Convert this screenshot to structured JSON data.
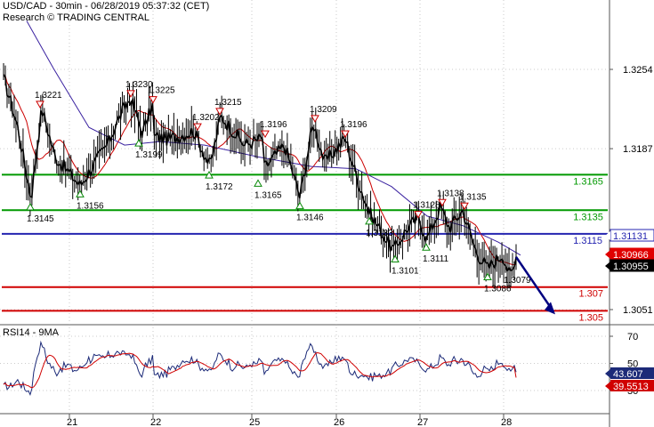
{
  "header": {
    "title": "USD/CAD - 30min - 06/28/2019 05:37:32 (CET)",
    "source": "Research © TRADING CENTRAL"
  },
  "rsi_panel": {
    "title": "RSI14 - 9MA"
  },
  "colors": {
    "price": "#000000",
    "ma_fast": "#cc0000",
    "ma_slow": "#3a22a0",
    "support": "#009900",
    "pivot": "#2424b0",
    "target": "#d00000",
    "arrow": "#000080",
    "up_marker": "#0a8a0a",
    "down_marker": "#cc0000"
  },
  "chart_data": [
    {
      "type": "candlestick",
      "title": "USD/CAD - 30min",
      "x_ticks": [
        "21",
        "22",
        "25",
        "26",
        "27",
        "28"
      ],
      "y_ticks": [
        1.3254,
        1.3187,
        1.3051
      ],
      "ylim": [
        1.3035,
        1.33
      ],
      "price_path": [
        {
          "label": "start",
          "y": 1.3245
        },
        {
          "label": "",
          "y": 1.3205
        },
        {
          "label": "low",
          "y": 1.3145
        },
        {
          "label": "",
          "y": 1.321
        },
        {
          "label": "high",
          "y": 1.3221
        },
        {
          "label": "",
          "y": 1.318
        },
        {
          "label": "low",
          "y": 1.3156
        },
        {
          "label": "",
          "y": 1.319
        },
        {
          "label": "",
          "y": 1.3215
        },
        {
          "label": "high",
          "y": 1.323
        },
        {
          "label": "",
          "y": 1.32
        },
        {
          "label": "high",
          "y": 1.3225
        },
        {
          "label": "low",
          "y": 1.3199
        },
        {
          "label": "",
          "y": 1.3195
        },
        {
          "label": "high",
          "y": 1.3202
        },
        {
          "label": "low",
          "y": 1.3172
        },
        {
          "label": "",
          "y": 1.32
        },
        {
          "label": "high",
          "y": 1.3215
        },
        {
          "label": "",
          "y": 1.319
        },
        {
          "label": "high",
          "y": 1.3196
        },
        {
          "label": "low",
          "y": 1.3165
        },
        {
          "label": "",
          "y": 1.319
        },
        {
          "label": "low",
          "y": 1.3146
        },
        {
          "label": "high",
          "y": 1.3209
        },
        {
          "label": "",
          "y": 1.3175
        },
        {
          "label": "high",
          "y": 1.3196
        },
        {
          "label": "",
          "y": 1.3165
        },
        {
          "label": "low",
          "y": 1.3133
        },
        {
          "label": "low",
          "y": 1.3101
        },
        {
          "label": "",
          "y": 1.312
        },
        {
          "label": "high",
          "y": 1.3128
        },
        {
          "label": "low",
          "y": 1.3111
        },
        {
          "label": "high",
          "y": 1.3138
        },
        {
          "label": "",
          "y": 1.312
        },
        {
          "label": "high",
          "y": 1.3135
        },
        {
          "label": "",
          "y": 1.31
        },
        {
          "label": "low",
          "y": 1.3086
        },
        {
          "label": "",
          "y": 1.3098
        },
        {
          "label": "low",
          "y": 1.3079
        },
        {
          "label": "last",
          "y": 1.30955
        }
      ],
      "series": [
        {
          "name": "",
          "values": "moving average (fast, red)"
        },
        {
          "name": "",
          "values": "moving average (slow, purple)"
        }
      ],
      "markers_down": [
        {
          "value": 1.3221,
          "label": "1.3221"
        },
        {
          "value": 1.323,
          "label": "1.3230"
        },
        {
          "value": 1.3225,
          "label": "1.3225"
        },
        {
          "value": 1.3202,
          "label": "1.3202"
        },
        {
          "value": 1.3215,
          "label": "1.3215"
        },
        {
          "value": 1.3196,
          "label": "1.3196"
        },
        {
          "value": 1.3209,
          "label": "1.3209"
        },
        {
          "value": 1.3196,
          "label": "1.3196"
        },
        {
          "value": 1.3128,
          "label": "1.3128"
        },
        {
          "value": 1.3138,
          "label": "1.3138"
        },
        {
          "value": 1.3135,
          "label": "1.3135"
        }
      ],
      "markers_up": [
        {
          "value": 1.3145,
          "label": "1.3145"
        },
        {
          "value": 1.3156,
          "label": "1.3156"
        },
        {
          "value": 1.3199,
          "label": "1.3199"
        },
        {
          "value": 1.3172,
          "label": "1.3172"
        },
        {
          "value": 1.3165,
          "label": "1.3165"
        },
        {
          "value": 1.3146,
          "label": "1.3146"
        },
        {
          "value": 1.3133,
          "label": "1.3133"
        },
        {
          "value": 1.3101,
          "label": "1.3101"
        },
        {
          "value": 1.3111,
          "label": "1.3111"
        },
        {
          "value": 1.3086,
          "label": "1.3086"
        }
      ],
      "low_label": {
        "value": 1.3079,
        "label": "1.3079"
      },
      "levels": [
        {
          "value": 1.3165,
          "label": "1.3165",
          "kind": "support"
        },
        {
          "value": 1.3135,
          "label": "1.3135",
          "kind": "support"
        },
        {
          "value": 1.3115,
          "label": "1.3115",
          "kind": "pivot"
        },
        {
          "value": 1.307,
          "label": "1.307",
          "kind": "target"
        },
        {
          "value": 1.305,
          "label": "1.305",
          "kind": "target"
        }
      ],
      "price_tags": [
        {
          "value": 1.31131,
          "label": "1.31131",
          "bg": "#ffffff",
          "fg": "#2424b0",
          "border": "#2424b0"
        },
        {
          "value": 1.30966,
          "label": "1.30966",
          "bg": "#e00000",
          "fg": "#ffffff",
          "border": "#e00000"
        },
        {
          "value": 1.30955,
          "label": "1.30955",
          "bg": "#000000",
          "fg": "#ffffff",
          "border": "#000000"
        }
      ],
      "forecast_arrow": {
        "from": 1.30955,
        "to": 1.305
      }
    },
    {
      "type": "line",
      "title": "RSI14 - 9MA",
      "y_ticks": [
        70,
        50,
        30
      ],
      "ylim": [
        15,
        82
      ],
      "rsi_value": 43.607,
      "rsi_ma_value": 39.5513,
      "tags": [
        {
          "value": 43.607,
          "label": "43.607",
          "bg": "#1c2a78",
          "fg": "#ffffff"
        },
        {
          "value": 39.5513,
          "label": "39.5513",
          "bg": "#d00000",
          "fg": "#ffffff"
        }
      ],
      "series": [
        {
          "name": "",
          "values": "RSI 14 (navy)"
        },
        {
          "name": "",
          "values": "9-period MA of RSI (red)"
        }
      ]
    }
  ]
}
